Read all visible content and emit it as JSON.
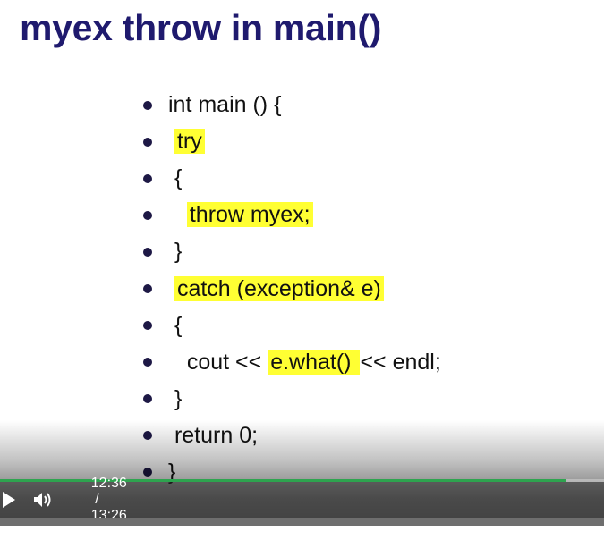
{
  "slide": {
    "title": "myex throw in main()",
    "lines": [
      {
        "pre": "int main () {",
        "hl": "",
        "post": ""
      },
      {
        "pre": " ",
        "hl": "try",
        "post": ""
      },
      {
        "pre": " {",
        "hl": "",
        "post": ""
      },
      {
        "pre": "   ",
        "hl": "throw myex;",
        "post": ""
      },
      {
        "pre": " }",
        "hl": "",
        "post": ""
      },
      {
        "pre": " ",
        "hl": "catch (exception& e)",
        "post": ""
      },
      {
        "pre": " {",
        "hl": "",
        "post": ""
      },
      {
        "pre": "   cout << ",
        "hl": "e.what() ",
        "post": "<< endl;"
      },
      {
        "pre": " }",
        "hl": "",
        "post": ""
      },
      {
        "pre": " return 0;",
        "hl": "",
        "post": ""
      },
      {
        "pre": "}",
        "hl": "",
        "post": ""
      }
    ],
    "highlight_color": "#ffff33"
  },
  "player": {
    "current_time": "12:36",
    "separator": "/",
    "duration": "13:26",
    "progress_fraction": 0.938,
    "play_icon": "play-icon",
    "volume_icon": "volume-icon",
    "accent": "#2ea44f"
  }
}
